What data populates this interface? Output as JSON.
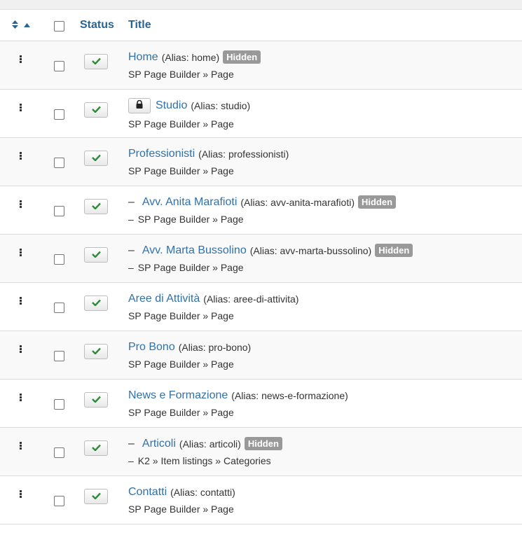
{
  "header": {
    "status_label": "Status",
    "title_label": "Title"
  },
  "icons": {
    "check_color": "#2f8a3a",
    "link_color": "#3071a9",
    "hidden_badge_color": "#999999"
  },
  "rows": [
    {
      "title": "Home",
      "alias": "(Alias: home)",
      "hidden": "Hidden",
      "sub": "SP Page Builder » Page",
      "child": false,
      "locked": false
    },
    {
      "title": "Studio",
      "alias": "(Alias: studio)",
      "hidden": null,
      "sub": "SP Page Builder » Page",
      "child": false,
      "locked": true
    },
    {
      "title": "Professionisti",
      "alias": "(Alias: professionisti)",
      "hidden": null,
      "sub": "SP Page Builder » Page",
      "child": false,
      "locked": false
    },
    {
      "title": "Avv. Anita Marafioti",
      "alias": "(Alias: avv-anita-marafioti)",
      "hidden": "Hidden",
      "sub": "SP Page Builder » Page",
      "child": true,
      "locked": false
    },
    {
      "title": "Avv. Marta Bussolino",
      "alias": "(Alias: avv-marta-bussolino)",
      "hidden": "Hidden",
      "sub": "SP Page Builder » Page",
      "child": true,
      "locked": false
    },
    {
      "title": "Aree di Attività",
      "alias": "(Alias: aree-di-attivita)",
      "hidden": null,
      "sub": "SP Page Builder » Page",
      "child": false,
      "locked": false
    },
    {
      "title": "Pro Bono",
      "alias": "(Alias: pro-bono)",
      "hidden": null,
      "sub": "SP Page Builder » Page",
      "child": false,
      "locked": false
    },
    {
      "title": "News e Formazione",
      "alias": "(Alias: news-e-formazione)",
      "hidden": null,
      "sub": "SP Page Builder » Page",
      "child": false,
      "locked": false
    },
    {
      "title": "Articoli",
      "alias": "(Alias: articoli)",
      "hidden": "Hidden",
      "sub": "K2 » Item listings » Categories",
      "child": true,
      "locked": false
    },
    {
      "title": "Contatti",
      "alias": "(Alias: contatti)",
      "hidden": null,
      "sub": "SP Page Builder » Page",
      "child": false,
      "locked": false
    }
  ]
}
